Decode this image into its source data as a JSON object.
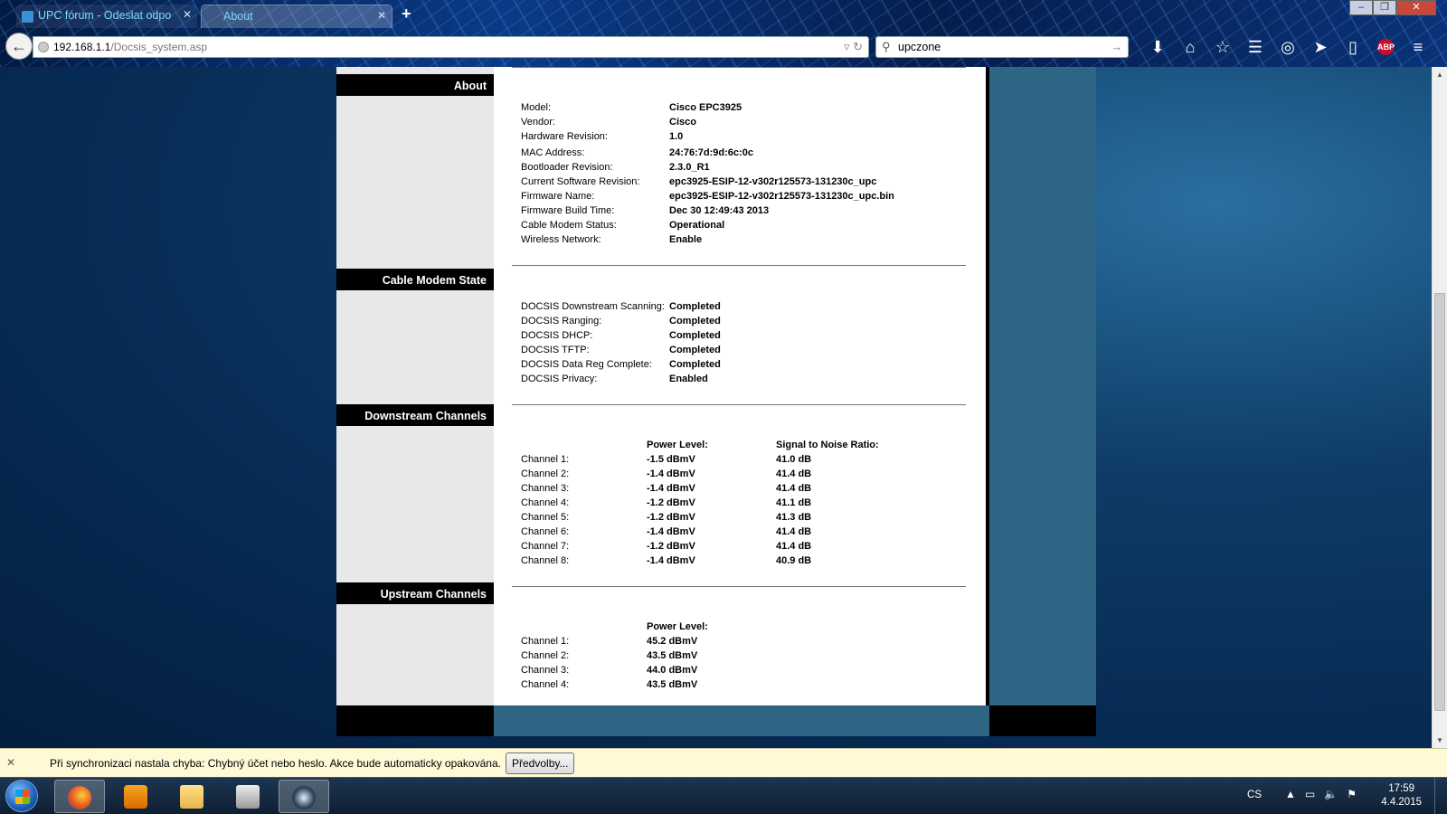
{
  "browser": {
    "tabs": [
      {
        "label": "UPC fórum - Odeslat odpo"
      },
      {
        "label": "About"
      }
    ],
    "new_tab_label": "+",
    "url_host": "192.168.1.1",
    "url_path": "/Docsis_system.asp",
    "search_value": "upczone",
    "abp_label": "ABP"
  },
  "sections": {
    "about": {
      "title": "About",
      "rows": [
        {
          "label": "Model:",
          "value": "Cisco EPC3925"
        },
        {
          "label": "Vendor:",
          "value": "Cisco"
        },
        {
          "label": "Hardware Revision:",
          "value": "1.0"
        },
        {
          "label": "MAC Address:",
          "value": "24:76:7d:9d:6c:0c"
        },
        {
          "label": "Bootloader Revision:",
          "value": "2.3.0_R1"
        },
        {
          "label": "Current Software Revision:",
          "value": "epc3925-ESIP-12-v302r125573-131230c_upc"
        },
        {
          "label": "Firmware Name:",
          "value": "epc3925-ESIP-12-v302r125573-131230c_upc.bin"
        },
        {
          "label": "Firmware Build Time:",
          "value": "Dec 30 12:49:43 2013"
        },
        {
          "label": "Cable Modem Status:",
          "value": "Operational"
        },
        {
          "label": "Wireless Network:",
          "value": "Enable"
        }
      ]
    },
    "cable_modem_state": {
      "title": "Cable Modem State",
      "rows": [
        {
          "label": "DOCSIS Downstream Scanning:",
          "value": "Completed"
        },
        {
          "label": "DOCSIS Ranging:",
          "value": "Completed"
        },
        {
          "label": "DOCSIS DHCP:",
          "value": "Completed"
        },
        {
          "label": "DOCSIS TFTP:",
          "value": "Completed"
        },
        {
          "label": "DOCSIS Data Reg Complete:",
          "value": "Completed"
        },
        {
          "label": "DOCSIS Privacy:",
          "value": "Enabled"
        }
      ]
    },
    "downstream": {
      "title": "Downstream Channels",
      "power_header": "Power Level:",
      "snr_header": "Signal to Noise Ratio:",
      "rows": [
        {
          "label": "Channel 1:",
          "power": "-1.5 dBmV",
          "snr": "41.0 dB"
        },
        {
          "label": "Channel 2:",
          "power": "-1.4 dBmV",
          "snr": "41.4 dB"
        },
        {
          "label": "Channel 3:",
          "power": "-1.4 dBmV",
          "snr": "41.4 dB"
        },
        {
          "label": "Channel 4:",
          "power": "-1.2 dBmV",
          "snr": "41.1 dB"
        },
        {
          "label": "Channel 5:",
          "power": "-1.2 dBmV",
          "snr": "41.3 dB"
        },
        {
          "label": "Channel 6:",
          "power": "-1.4 dBmV",
          "snr": "41.4 dB"
        },
        {
          "label": "Channel 7:",
          "power": "-1.2 dBmV",
          "snr": "41.4 dB"
        },
        {
          "label": "Channel 8:",
          "power": "-1.4 dBmV",
          "snr": "40.9 dB"
        }
      ]
    },
    "upstream": {
      "title": "Upstream Channels",
      "power_header": "Power Level:",
      "rows": [
        {
          "label": "Channel 1:",
          "power": "45.2 dBmV"
        },
        {
          "label": "Channel 2:",
          "power": "43.5 dBmV"
        },
        {
          "label": "Channel 3:",
          "power": "44.0 dBmV"
        },
        {
          "label": "Channel 4:",
          "power": "43.5 dBmV"
        }
      ]
    }
  },
  "notification": {
    "message": "Při synchronizaci nastala chyba: Chybný účet nebo heslo. Akce bude automaticky opakována.",
    "button_label": "Předvolby..."
  },
  "taskbar": {
    "language": "CS",
    "time": "17:59",
    "date": "4.4.2015"
  },
  "colors": {
    "page_background": "#062a52",
    "frame": "#2e6584",
    "section_header": "#000000"
  }
}
